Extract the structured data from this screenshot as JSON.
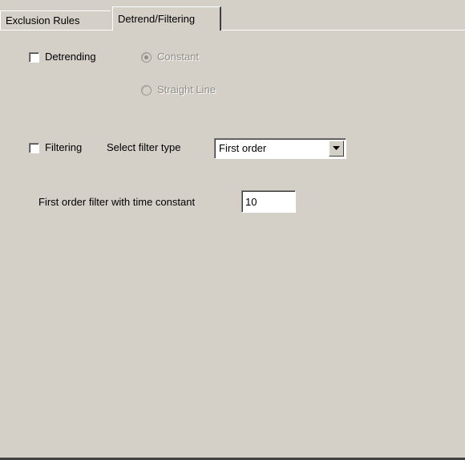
{
  "tabs": [
    {
      "label": "Exclusion Rules",
      "active": false
    },
    {
      "label": "Detrend/Filtering",
      "active": true
    }
  ],
  "detrending": {
    "checkbox_label": "Detrending",
    "checked": false,
    "options": [
      {
        "label": "Constant",
        "selected": true,
        "enabled": false
      },
      {
        "label": "Straight Line",
        "selected": false,
        "enabled": false
      }
    ]
  },
  "filtering": {
    "checkbox_label": "Filtering",
    "checked": false,
    "select_label": "Select filter type",
    "select_value": "First order"
  },
  "time_constant": {
    "label": "First order filter with time constant",
    "value": "10"
  },
  "colors": {
    "panel_background": "#d4d0c8",
    "disabled_text": "#8f8d87"
  },
  "icons": {
    "dropdown": "chevron-down-icon"
  }
}
